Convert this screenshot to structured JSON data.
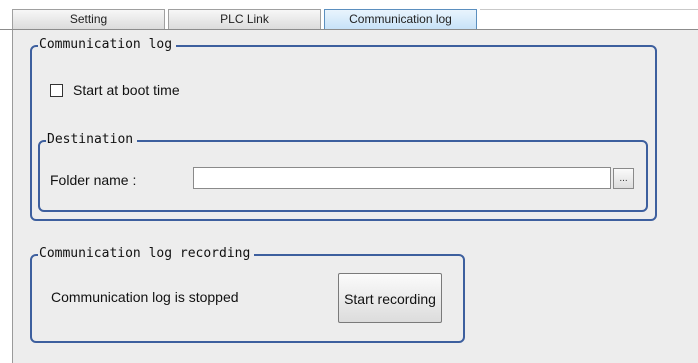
{
  "tabs": [
    {
      "label": "Setting",
      "active": false
    },
    {
      "label": "PLC Link",
      "active": false
    },
    {
      "label": "Communication log",
      "active": true
    }
  ],
  "communication_log": {
    "title": "Communication log",
    "start_at_boot": {
      "label": "Start at boot time",
      "checked": false
    },
    "destination": {
      "title": "Destination",
      "folder_label": "Folder name :",
      "folder_value": "",
      "browse_label": "..."
    }
  },
  "recording": {
    "title": "Communication log recording",
    "status_text": "Communication log is stopped",
    "button_label": "Start recording"
  },
  "colors": {
    "group_border": "#3d5f9e",
    "panel_background": "#ededed",
    "active_tab": "#c7e2f8"
  }
}
